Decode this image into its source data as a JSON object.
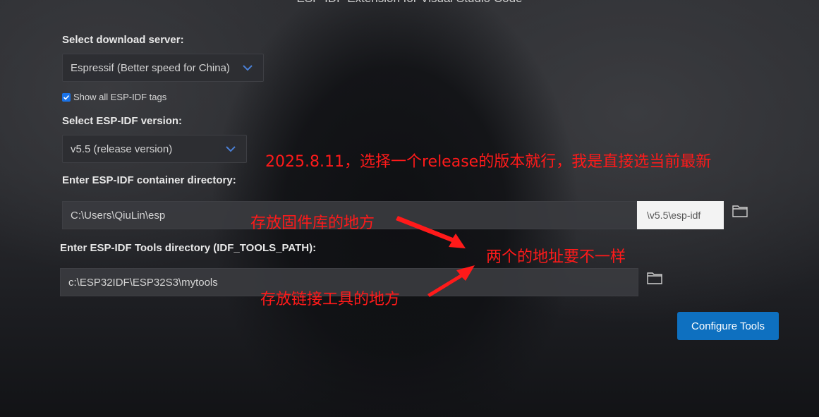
{
  "header": {
    "title": "ESP-IDF Extension for Visual Studio Code"
  },
  "download_server": {
    "label": "Select download server:",
    "selected": "Espressif (Better speed for China)"
  },
  "show_tags": {
    "label": "Show all ESP-IDF tags",
    "checked": true
  },
  "idf_version": {
    "label": "Select ESP-IDF version:",
    "selected": "v5.5 (release version)"
  },
  "container_dir": {
    "label": "Enter ESP-IDF container directory:",
    "value": "C:\\Users\\QiuLin\\esp",
    "suffix": "\\v5.5\\esp-idf"
  },
  "tools_dir": {
    "label": "Enter ESP-IDF Tools directory (IDF_TOOLS_PATH):",
    "value": "c:\\ESP32IDF\\ESP32S3\\mytools"
  },
  "configure_button": {
    "label": "Configure Tools"
  },
  "annotations": {
    "note_version": "2025.8.11，选择一个release的版本就行，我是直接选当前最新",
    "note_firmware": "存放固件库的地方",
    "note_different": "两个的地址要不一样",
    "note_tools": "存放链接工具的地方",
    "color": "#ff1a1a"
  },
  "icons": {
    "dropdown": "chevron-down-icon",
    "folder": "folder-icon",
    "checkbox": "checkmark-icon"
  },
  "colors": {
    "accent": "#0e70c0",
    "chevron": "#4a7fd4",
    "annotation": "#ff1a1a"
  }
}
